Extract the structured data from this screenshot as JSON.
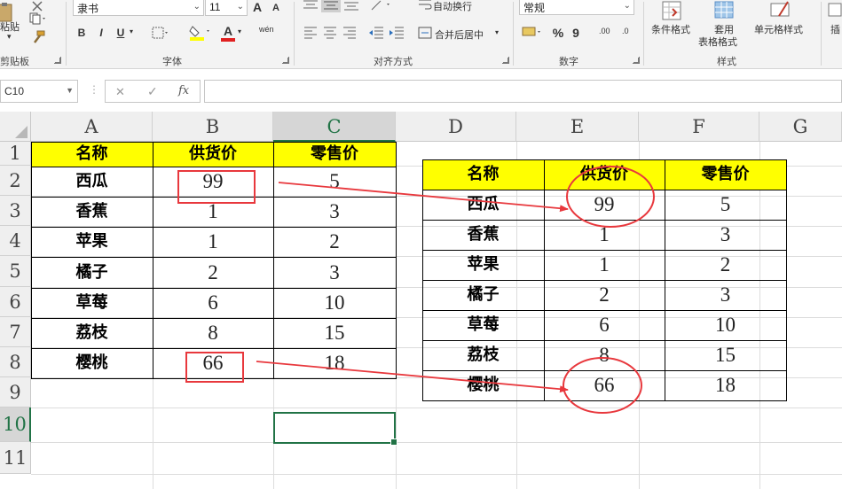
{
  "ribbon": {
    "clipboard": {
      "paste_label": "粘贴",
      "group_label": "剪贴板"
    },
    "font": {
      "font_name": "隶书",
      "font_size": "11",
      "grow_label": "A",
      "shrink_label": "A",
      "bold_label": "B",
      "italic_label": "I",
      "underline_label": "U",
      "color_label": "A",
      "phonetic_label": "wén",
      "group_label": "字体"
    },
    "alignment": {
      "wrap_label": "自动换行",
      "merge_label": "合并后居中",
      "group_label": "对齐方式"
    },
    "number": {
      "format_value": "常规",
      "currency_label": "$",
      "percent_label": "%",
      "comma_label": "9",
      "inc_decimal_label": ".00",
      "dec_decimal_label": ".0",
      "group_label": "数字"
    },
    "styles": {
      "conditional_label": "条件格式",
      "table_label_1": "套用",
      "table_label_2": "表格格式",
      "cell_styles_label": "单元格样式",
      "group_label": "样式"
    },
    "cells": {
      "insert_label": "插"
    }
  },
  "formula_bar": {
    "name_box": "C10",
    "fx_label": "fx",
    "cancel_label": "✕",
    "enter_label": "✓",
    "value": ""
  },
  "grid": {
    "columns": [
      "A",
      "B",
      "C",
      "D",
      "E",
      "F",
      "G"
    ],
    "rows": [
      "1",
      "2",
      "3",
      "4",
      "5",
      "6",
      "7",
      "8",
      "9",
      "10",
      "11"
    ],
    "selected_cell": "C10"
  },
  "left_table": {
    "headers": [
      "名称",
      "供货价",
      "零售价"
    ],
    "rows": [
      [
        "西瓜",
        "99",
        "5"
      ],
      [
        "香蕉",
        "1",
        "3"
      ],
      [
        "苹果",
        "1",
        "2"
      ],
      [
        "橘子",
        "2",
        "3"
      ],
      [
        "草莓",
        "6",
        "10"
      ],
      [
        "荔枝",
        "8",
        "15"
      ],
      [
        "樱桃",
        "66",
        "18"
      ]
    ]
  },
  "right_table": {
    "headers": [
      "名称",
      "供货价",
      "零售价"
    ],
    "rows": [
      [
        "西瓜",
        "99",
        "5"
      ],
      [
        "香蕉",
        "1",
        "3"
      ],
      [
        "苹果",
        "1",
        "2"
      ],
      [
        "橘子",
        "2",
        "3"
      ],
      [
        "草莓",
        "6",
        "10"
      ],
      [
        "荔枝",
        "8",
        "15"
      ],
      [
        "樱桃",
        "66",
        "18"
      ]
    ]
  },
  "annotation_color": "#e8383d",
  "header_fill": "#ffff00",
  "accent_color": "#217346"
}
